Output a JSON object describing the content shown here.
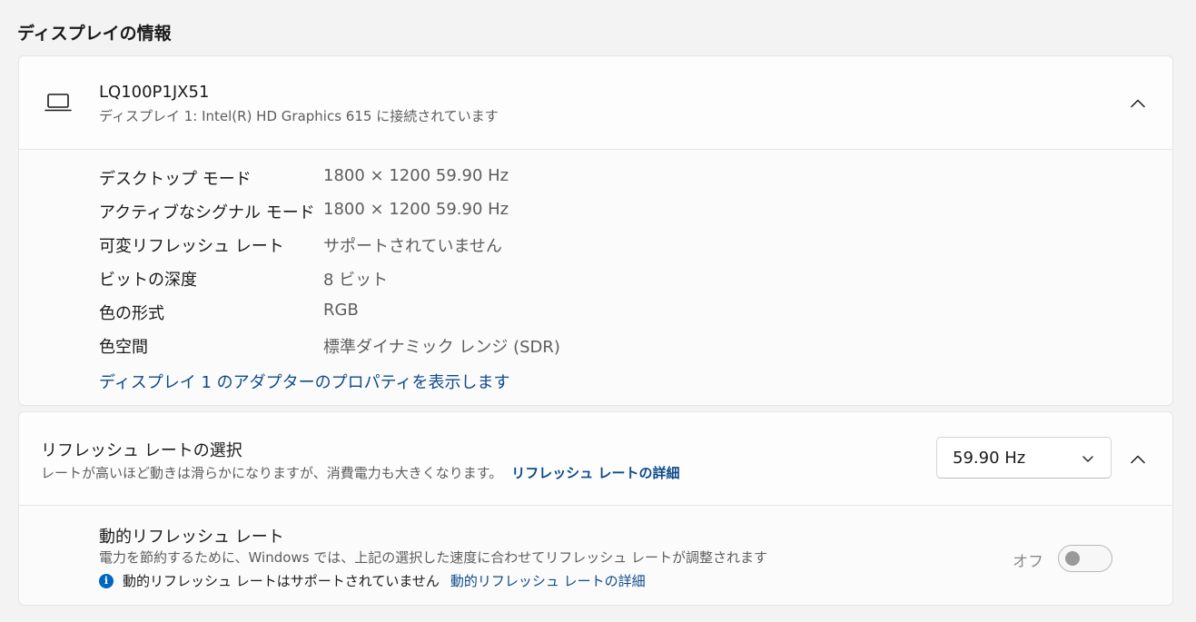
{
  "section_title": "ディスプレイの情報",
  "display": {
    "name": "LQ100P1JX51",
    "subtitle": "ディスプレイ 1: Intel(R) HD Graphics 615 に接続されています",
    "expanded": true,
    "details": [
      {
        "label": "デスクトップ モード",
        "value": "1800 × 1200 59.90 Hz"
      },
      {
        "label": "アクティブなシグナル モード",
        "value": "1800 × 1200 59.90 Hz"
      },
      {
        "label": "可変リフレッシュ レート",
        "value": "サポートされていません"
      },
      {
        "label": "ビットの深度",
        "value": "8 ビット"
      },
      {
        "label": "色の形式",
        "value": "RGB"
      },
      {
        "label": "色空間",
        "value": "標準ダイナミック レンジ (SDR)"
      }
    ],
    "adapter_link": "ディスプレイ 1 のアダプターのプロパティを表示します"
  },
  "refresh": {
    "title": "リフレッシュ レートの選択",
    "description": "レートが高いほど動きは滑らかになりますが、消費電力も大きくなります。",
    "details_link": "リフレッシュ レートの詳細",
    "selected_rate": "59.90 Hz",
    "dynamic": {
      "title": "動的リフレッシュ レート",
      "description": "電力を節約するために、Windows では、上記の選択した速度に合わせてリフレッシュ レートが調整されます",
      "note": "動的リフレッシュ レートはサポートされていません",
      "note_link": "動的リフレッシュ レートの詳細",
      "toggle_label": "オフ",
      "toggle_on": false
    }
  },
  "colors": {
    "link": "#0e4b8a",
    "info_icon": "#0067c0",
    "background": "#f3f3f3"
  },
  "icons": {
    "display": "laptop-icon",
    "collapse": "chevron-up-icon",
    "dropdown": "chevron-down-icon",
    "note": "info-icon"
  }
}
